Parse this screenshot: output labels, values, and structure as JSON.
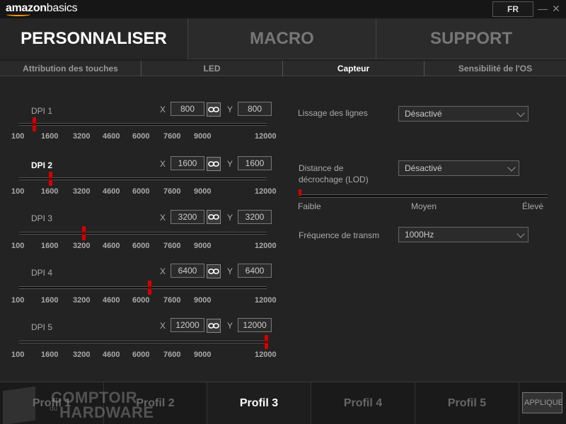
{
  "titlebar": {
    "logo_main": "amazon",
    "logo_sub": "basics",
    "lang": "FR",
    "minimize": "—",
    "close": "✕"
  },
  "main_tabs": [
    "PERSONNALISER",
    "MACRO",
    "SUPPORT"
  ],
  "active_main_tab": "PERSONNALISER",
  "sub_tabs": [
    "Attribution des touches",
    "LED",
    "Capteur",
    "Sensibilité de l'OS"
  ],
  "active_sub_tab": "Capteur",
  "dpi": {
    "x_label": "X",
    "y_label": "Y",
    "ticks": [
      "100",
      "1600",
      "3200",
      "4600",
      "6000",
      "7600",
      "9000",
      "12000"
    ],
    "stages": [
      {
        "label": "DPI 1",
        "x": "800",
        "y": "800",
        "value": 800
      },
      {
        "label": "DPI 2",
        "x": "1600",
        "y": "1600",
        "value": 1600
      },
      {
        "label": "DPI 3",
        "x": "3200",
        "y": "3200",
        "value": 3200
      },
      {
        "label": "DPI 4",
        "x": "6400",
        "y": "6400",
        "value": 6400
      },
      {
        "label": "DPI 5",
        "x": "12000",
        "y": "12000",
        "value": 12000
      }
    ],
    "active_stage": "DPI 2"
  },
  "settings": {
    "smoothing_label": "Lissage des lignes",
    "smoothing_value": "Désactivé",
    "lod_label_1": "Distance de",
    "lod_label_2": "décrochage (LOD)",
    "lod_value": "Désactivé",
    "lod_level": 0,
    "lod_min": "Faible",
    "lod_mid": "Moyen",
    "lod_max": "Élevé",
    "polling_label": "Fréquence de transm",
    "polling_value": "1000Hz"
  },
  "profiles": [
    "Profil 1",
    "Profil 2",
    "Profil 3",
    "Profil 4",
    "Profil 5"
  ],
  "active_profile": "Profil 3",
  "apply_label": "APPLIQUER",
  "watermark": {
    "line1": "COMPTOIR",
    "du": "du",
    "line2": "HARDWARE"
  },
  "colors": {
    "accent": "#d40000",
    "background": "#232323"
  }
}
